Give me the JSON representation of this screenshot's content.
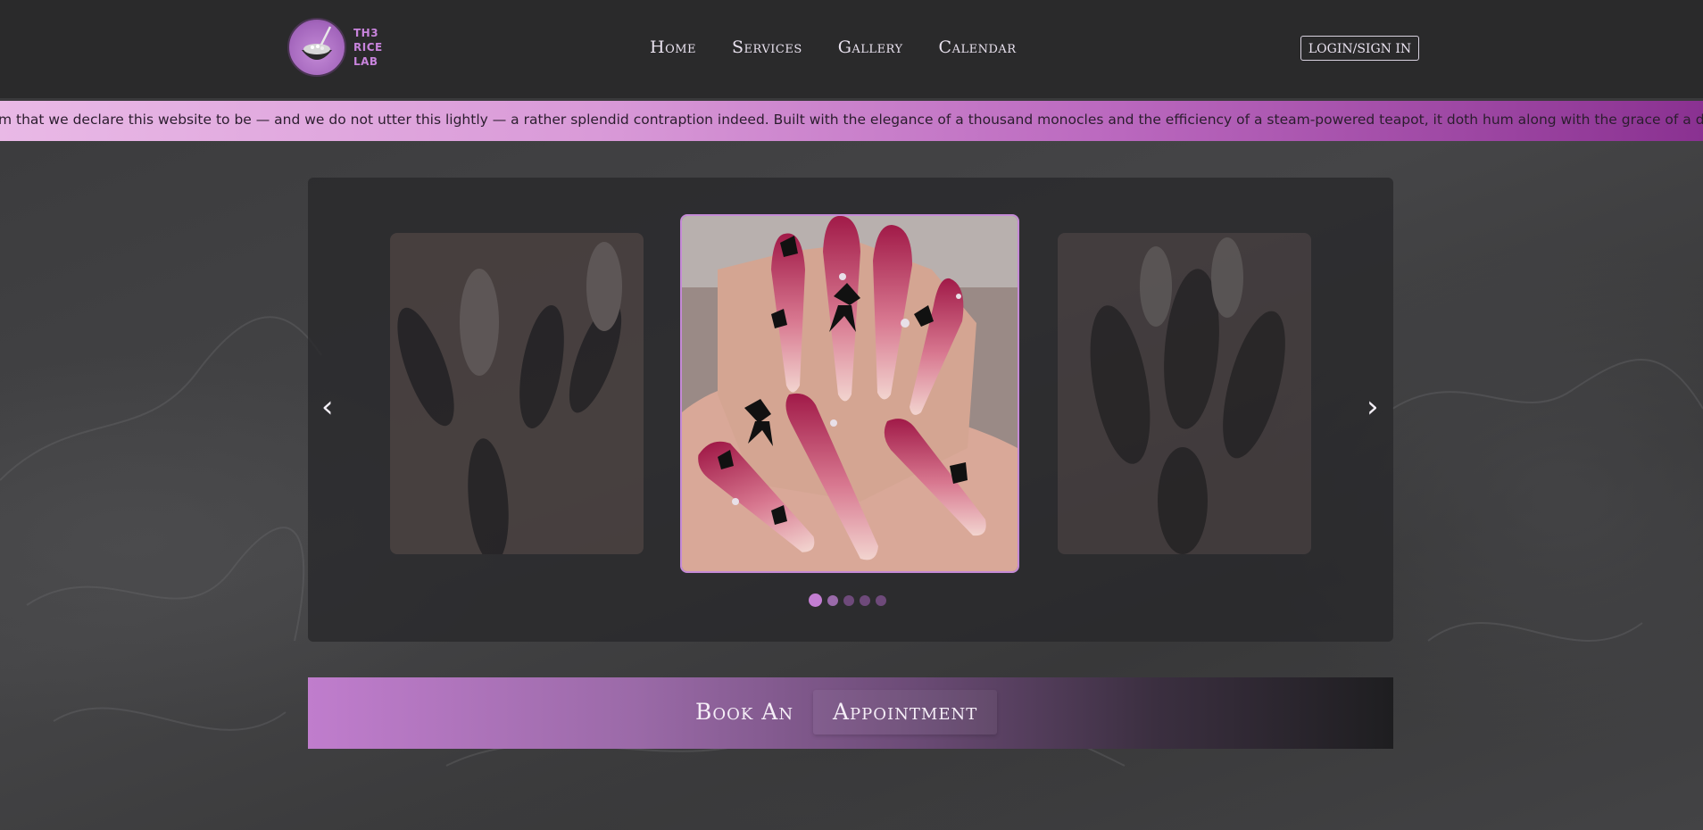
{
  "brand": {
    "logo_line1": "TH3",
    "logo_line2": "RICE",
    "logo_line3": "LAB"
  },
  "nav": {
    "home": "Home",
    "services": "Services",
    "gallery": "Gallery",
    "calendar": "Calendar"
  },
  "auth": {
    "login_label": "LOGIN/SIGN IN"
  },
  "ticker": {
    "text": "m that we declare this website to be — and we do not utter this lightly — a rather splendid contraption indeed. Built with the elegance of a thousand monocles and the efficiency of a steam-powered teapot, it doth hum along with the grace of a debutante at her fi"
  },
  "carousel": {
    "prev_arrow": "‹",
    "next_arrow": "›",
    "slide_count": 5,
    "active_slide": 1
  },
  "cta": {
    "part1": "Book An",
    "part2": "Appointment"
  },
  "colors": {
    "accent": "#c37ed2",
    "header_bg": "#2a2a2b",
    "ticker_start": "#e9b9e6",
    "ticker_end": "#8a3191"
  }
}
